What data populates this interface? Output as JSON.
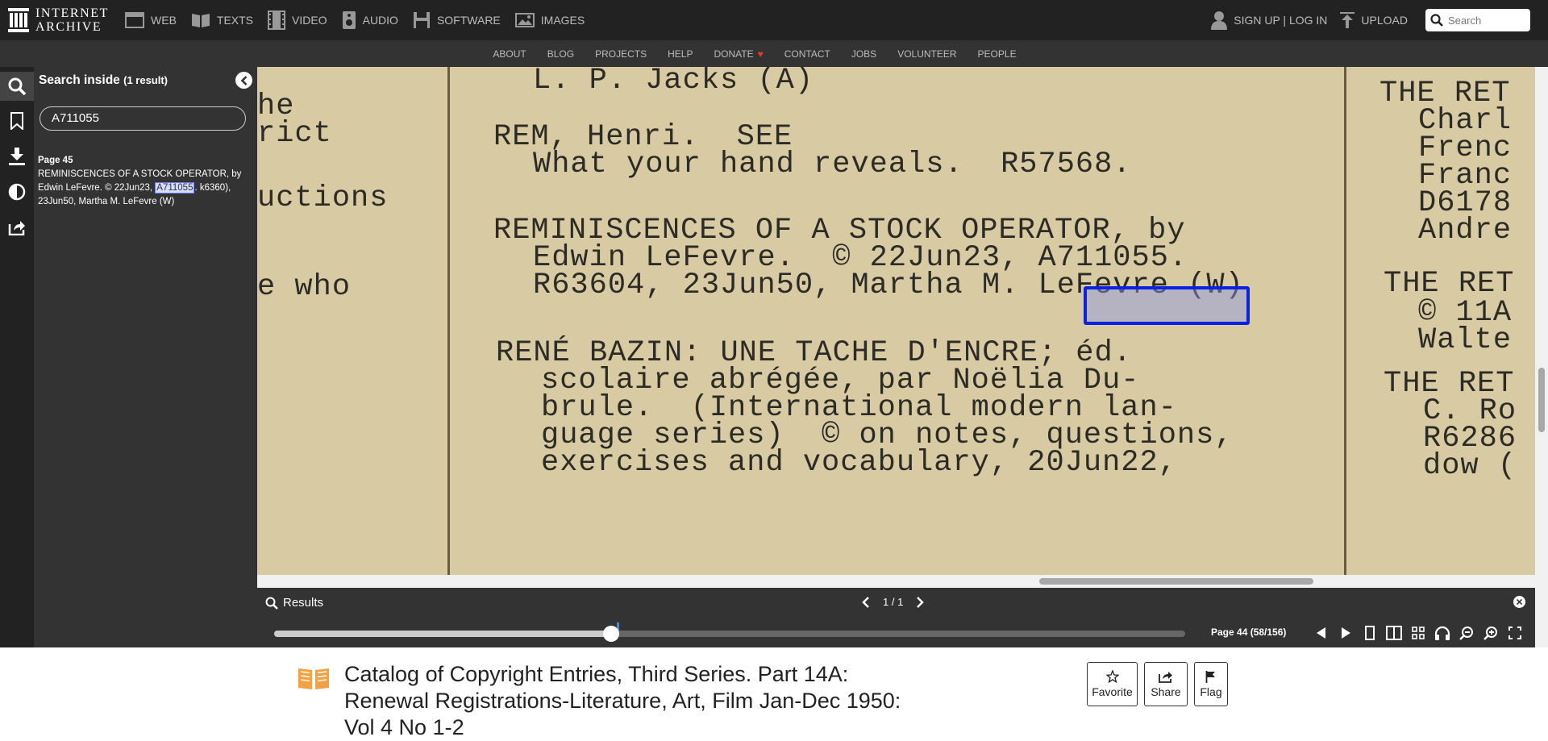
{
  "topnav": {
    "logo_line1": "INTERNET",
    "logo_line2": "ARCHIVE",
    "media": [
      {
        "label": "WEB",
        "icon": "web-icon"
      },
      {
        "label": "TEXTS",
        "icon": "book-icon"
      },
      {
        "label": "VIDEO",
        "icon": "film-icon"
      },
      {
        "label": "AUDIO",
        "icon": "speaker-icon"
      },
      {
        "label": "SOFTWARE",
        "icon": "floppy-icon"
      },
      {
        "label": "IMAGES",
        "icon": "image-icon"
      }
    ],
    "signup": "SIGN UP | LOG IN",
    "upload": "UPLOAD",
    "search_placeholder": "Search"
  },
  "subnav": {
    "items": [
      "ABOUT",
      "BLOG",
      "PROJECTS",
      "HELP",
      "DONATE",
      "CONTACT",
      "JOBS",
      "VOLUNTEER",
      "PEOPLE"
    ]
  },
  "search_panel": {
    "title": "Search inside",
    "count": "(1 result)",
    "query": "A711055",
    "result": {
      "page": "Page 45",
      "before": "REMINISCENCES OF A STOCK OPERATOR, by Edwin LeFevre. © 22Jun23, ",
      "match": "A711055",
      "after": ". k6360), 23Jun50, Martha M. LeFevre (W)"
    }
  },
  "scan": {
    "lines": [
      "he",
      "rict",
      "uctions",
      "e who",
      "L. P. Jacks (A)",
      "REM, Henri.  SEE",
      "What your hand reveals.  R57568.",
      "REMINISCENCES OF A STOCK OPERATOR, by",
      "Edwin LeFevre.  © 22Jun23, A711055.",
      "R63604, 23Jun50, Martha M. LeFevre (W)",
      "RENÉ BAZIN: UNE TACHE D'ENCRE; éd.",
      "scolaire abrégée, par Noëlia Du-",
      "brule.  (International modern lan-",
      "guage series)  © on notes, questions,",
      "exercises and vocabulary, 20Jun22,",
      "THE RET",
      "Charl",
      "Frenc",
      "Franc",
      "D6178",
      "Andre",
      "THE RET",
      "© 11A",
      "Walte",
      "THE RET",
      "C. Ro",
      "R6286",
      "dow ("
    ]
  },
  "results_bar": {
    "label": "Results",
    "counter": "1 / 1"
  },
  "navbar": {
    "page_label": "Page 44 (58/156)",
    "progress": 0.37
  },
  "item": {
    "title": "Catalog of Copyright Entries, Third Series. Part 14A: Renewal Registrations-Literature, Art, Film Jan-Dec 1950: Vol 4 No 1-2",
    "favorite": "Favorite",
    "share": "Share",
    "flag": "Flag"
  },
  "colors": {
    "topbar": "#222222",
    "subnav": "#333333",
    "highlight_border": "#0b22e0",
    "book_icon": "#f5a142",
    "heart": "#ee3333"
  }
}
